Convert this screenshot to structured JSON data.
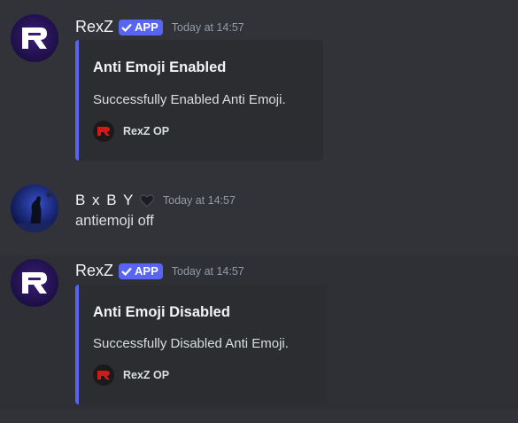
{
  "messages": [
    {
      "author": "RexZ",
      "badge": "APP",
      "timestamp": "Today at 14:57",
      "embed": {
        "title": "Anti Emoji Enabled",
        "description": "Successfully Enabled Anti Emoji.",
        "footer": "RexZ OP",
        "accent_color": "#5865f2"
      }
    },
    {
      "author": "B x B Y",
      "author_icon": "black-heart-icon",
      "timestamp": "Today at 14:57",
      "content": "antiemoji off"
    },
    {
      "author": "RexZ",
      "badge": "APP",
      "timestamp": "Today at 14:57",
      "embed": {
        "title": "Anti Emoji Disabled",
        "description": "Successfully Disabled Anti Emoji.",
        "footer": "RexZ OP",
        "accent_color": "#5865f2"
      }
    }
  ],
  "colors": {
    "background": "#313338",
    "embed_background": "#2b2d31",
    "app_badge": "#5865f2",
    "timestamp": "#949ba4"
  }
}
